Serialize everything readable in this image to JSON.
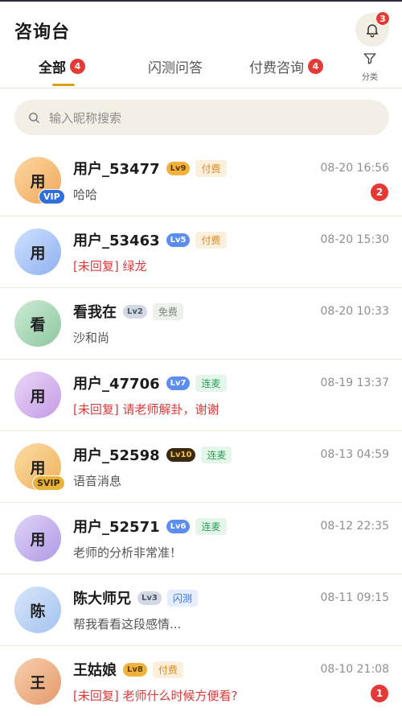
{
  "header": {
    "title": "咨询台",
    "notification_count": "3"
  },
  "tabs": [
    {
      "label": "全部",
      "badge": "4"
    },
    {
      "label": "闪测问答"
    },
    {
      "label": "付费咨询",
      "badge": "4"
    }
  ],
  "filter": {
    "label": "分类",
    "icon": "filter-icon"
  },
  "search": {
    "placeholder": "输入昵称搜索",
    "icon": "search-icon"
  },
  "colors": {
    "accent": "#d9a21c",
    "unread": "#e53935",
    "vip": "#2f6fdc"
  },
  "conversations": [
    {
      "avatar_text": "用",
      "vip": "VIP",
      "name": "用户_53477",
      "level": "Lv9",
      "tag": "付费",
      "time": "08-20 16:56",
      "prefix": "",
      "message": "哈哈",
      "unread": "2"
    },
    {
      "avatar_text": "用",
      "name": "用户_53463",
      "level": "Lv5",
      "tag": "付费",
      "time": "08-20 15:30",
      "prefix": "[未回复]",
      "message": "绿龙"
    },
    {
      "avatar_text": "看",
      "name": "看我在",
      "level": "Lv2",
      "tag": "免费",
      "time": "08-20 10:33",
      "prefix": "",
      "message": "沙和尚"
    },
    {
      "avatar_text": "用",
      "name": "用户_47706",
      "level": "Lv7",
      "tag": "连麦",
      "time": "08-19 13:37",
      "prefix": "[未回复]",
      "message": "请老师解卦，谢谢"
    },
    {
      "avatar_text": "用",
      "vip": "SVIP",
      "name": "用户_52598",
      "level": "Lv10",
      "tag": "连麦",
      "time": "08-13 04:59",
      "prefix": "",
      "message": "语音消息"
    },
    {
      "avatar_text": "用",
      "name": "用户_52571",
      "level": "Lv6",
      "tag": "连麦",
      "time": "08-12 22:35",
      "prefix": "",
      "message": "老师的分析非常准！"
    },
    {
      "avatar_text": "陈",
      "name": "陈大师兄",
      "level": "Lv3",
      "tag": "闪测",
      "time": "08-11 09:15",
      "prefix": "",
      "message": "帮我看看这段感情..."
    },
    {
      "avatar_text": "王",
      "name": "王姑娘",
      "level": "Lv8",
      "tag": "付费",
      "time": "08-10 21:08",
      "prefix": "[未回复]",
      "message": "老师什么时候方便看?",
      "unread": "1"
    }
  ]
}
